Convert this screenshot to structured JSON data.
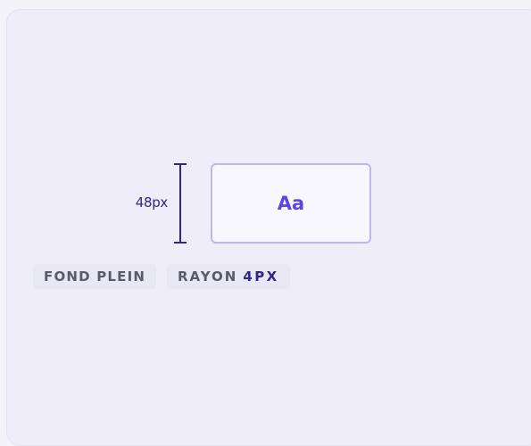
{
  "measure": {
    "label": "48px"
  },
  "preview": {
    "sample_text": "Aa"
  },
  "tags": {
    "fill_label": "FOND PLEIN",
    "radius_label": "RAYON",
    "radius_value": "4PX"
  },
  "colors": {
    "accent": "#5a45e6",
    "measure_line": "#2f2685",
    "preview_border": "#bcb8f0",
    "card_background": "#eeedf8"
  }
}
